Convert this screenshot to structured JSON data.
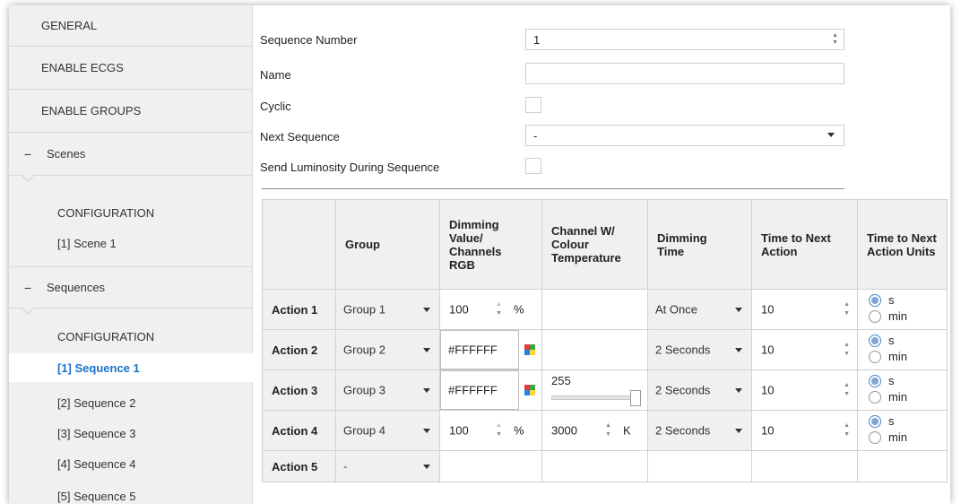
{
  "sidebar": {
    "general": "GENERAL",
    "enable_ecgs": "ENABLE ECGS",
    "enable_groups": "ENABLE GROUPS",
    "scenes": {
      "label": "Scenes",
      "collapse": "−",
      "items": [
        "CONFIGURATION",
        "[1] Scene 1"
      ]
    },
    "sequences": {
      "label": "Sequences",
      "collapse": "−",
      "items": [
        "CONFIGURATION",
        "[1] Sequence 1",
        "[2] Sequence 2",
        "[3] Sequence 3",
        "[4] Sequence 4",
        "[5] Sequence 5"
      ],
      "active_index": 1
    }
  },
  "form": {
    "sequence_number": {
      "label": "Sequence Number",
      "value": "1"
    },
    "name": {
      "label": "Name",
      "value": ""
    },
    "cyclic": {
      "label": "Cyclic",
      "checked": false
    },
    "next_sequence": {
      "label": "Next Sequence",
      "value": "-"
    },
    "send_luminosity": {
      "label": "Send Luminosity During Sequence",
      "checked": false
    }
  },
  "table": {
    "headers": {
      "group": "Group",
      "dimming_value": [
        "Dimming",
        "Value/",
        "Channels",
        "RGB"
      ],
      "channel_w": [
        "Channel W/",
        "Colour",
        "Temperature"
      ],
      "dimming_time": [
        "Dimming",
        "Time"
      ],
      "time_next": [
        "Time to Next",
        "Action"
      ],
      "time_next_units": [
        "Time to Next",
        "Action Units"
      ]
    },
    "spin_up": "▲",
    "spin_down": "▼",
    "unit_s": "s",
    "unit_min": "min",
    "rows": [
      {
        "action": "Action 1",
        "group": "Group 1",
        "dim_value": "100",
        "dim_unit": "%",
        "channel_w": "",
        "dim_time": "At Once",
        "time_next": "10",
        "units": "s"
      },
      {
        "action": "Action 2",
        "group": "Group 2",
        "dim_value": "#FFFFFF",
        "dim_unit": "",
        "channel_w": "",
        "dim_time": "2 Seconds",
        "time_next": "10",
        "units": "s"
      },
      {
        "action": "Action 3",
        "group": "Group 3",
        "dim_value": "#FFFFFF",
        "dim_unit": "",
        "channel_w": "255",
        "dim_time": "2 Seconds",
        "time_next": "10",
        "units": "s"
      },
      {
        "action": "Action 4",
        "group": "Group 4",
        "dim_value": "100",
        "dim_unit": "%",
        "channel_w": "3000",
        "channel_w_unit": "K",
        "dim_time": "2 Seconds",
        "time_next": "10",
        "units": "s"
      },
      {
        "action": "Action 5",
        "group": "-"
      }
    ]
  },
  "colors": {
    "accent": "#1a73c8",
    "header_bg": "#f0f0f0",
    "palette": [
      "#e53935",
      "#43a047",
      "#1e88e5",
      "#fdd835"
    ]
  }
}
